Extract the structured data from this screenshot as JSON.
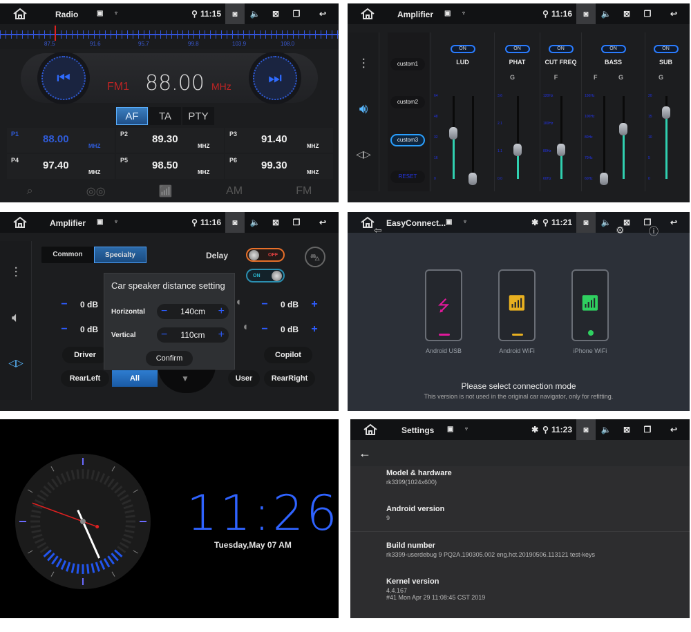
{
  "radio": {
    "title": "Radio",
    "time": "11:15",
    "scale_labels": [
      "87.5",
      "91.6",
      "95.7",
      "99.8",
      "103.9",
      "108.0"
    ],
    "band": "FM1",
    "frequency": "88.00",
    "unit": "MHz",
    "tabs": [
      {
        "label": "AF",
        "active": true
      },
      {
        "label": "TA",
        "active": false
      },
      {
        "label": "PTY",
        "active": false
      }
    ],
    "presets": [
      {
        "name": "P1",
        "value": "88.00",
        "unit": "MHZ",
        "selected": true
      },
      {
        "name": "P2",
        "value": "89.30",
        "unit": "MHZ"
      },
      {
        "name": "P3",
        "value": "91.40",
        "unit": "MHZ"
      },
      {
        "name": "P4",
        "value": "97.40",
        "unit": "MHZ"
      },
      {
        "name": "P5",
        "value": "98.50",
        "unit": "MHZ"
      },
      {
        "name": "P6",
        "value": "99.30",
        "unit": "MHZ"
      }
    ],
    "bottom": {
      "search": "⌕",
      "stereo": "◎◎",
      "antenna": "📶",
      "am": "AM",
      "fm": "FM"
    }
  },
  "amp_eq": {
    "title": "Amplifier",
    "time": "11:16",
    "presets": [
      "custom1",
      "custom2",
      "custom3",
      "RESET"
    ],
    "selected_preset": "custom3",
    "columns": [
      {
        "name": "LUD",
        "toggle": "ON",
        "sub": "",
        "ticks": [
          "64",
          "48",
          "32",
          "16",
          "0"
        ],
        "sliders": [
          0.55,
          0.0
        ]
      },
      {
        "name": "PHAT",
        "toggle": "ON",
        "sub": "G",
        "ticks": [
          "3.6",
          "2.1",
          "1.1",
          "0.0"
        ],
        "sliders": [
          0.35
        ]
      },
      {
        "name": "CUT FREQ",
        "toggle": "ON",
        "sub": "F",
        "ticks": [
          "120Hz",
          "100Hz",
          "80Hz",
          "60Hz"
        ],
        "sliders": [
          0.35
        ]
      },
      {
        "name": "BASS",
        "toggle": "ON",
        "sub": "F G",
        "ticks": [
          "150Hz",
          "100Hz",
          "80Hz",
          "70Hz",
          "60Hz"
        ],
        "sliders": [
          0.0,
          0.6
        ]
      },
      {
        "name": "SUB",
        "toggle": "ON",
        "sub": "G",
        "ticks": [
          "20",
          "15",
          "10",
          "5",
          "0"
        ],
        "sliders": [
          0.8
        ]
      }
    ]
  },
  "amp_spec": {
    "title": "Amplifier",
    "time": "11:16",
    "tabs": [
      "Common",
      "Specialty"
    ],
    "active_tab": "Specialty",
    "delay_label": "Delay",
    "toggle_off": "OFF",
    "toggle_on": "ON",
    "levels": [
      "0 dB",
      "0 dB",
      "0 dB",
      "0 dB"
    ],
    "dialog": {
      "title": "Car speaker distance setting",
      "horizontal_label": "Horizontal",
      "horizontal_value": "140cm",
      "vertical_label": "Vertical",
      "vertical_value": "110cm",
      "confirm": "Confirm"
    },
    "positions": [
      "Driver",
      "Copilot",
      "RearLeft",
      "All",
      "User",
      "RearRight"
    ]
  },
  "easyconnect": {
    "title": "EasyConnect...",
    "time": "11:21",
    "modes": [
      {
        "label": "Android USB",
        "color": "#e0199a",
        "icon": "usb"
      },
      {
        "label": "Android WiFi",
        "color": "#e8b020",
        "icon": "wifi"
      },
      {
        "label": "iPhone WiFi",
        "color": "#2fd060",
        "icon": "wifi"
      }
    ],
    "prompt": "Please select connection mode",
    "note": "This version is not used in the original car navigator, only for refitting."
  },
  "clock": {
    "time": "11:26",
    "date": "Tuesday,May 07 AM"
  },
  "settings": {
    "title": "Settings",
    "time": "11:23",
    "items": [
      {
        "title": "Model & hardware",
        "lines": [
          "rk3399(1024x600)"
        ]
      },
      {
        "title": "Android version",
        "lines": [
          "9"
        ]
      },
      {
        "title": "Build number",
        "lines": [
          "rk3399-userdebug 9 PQ2A.190305.002 eng.hct.20190506.113121 test-keys"
        ]
      },
      {
        "title": "Kernel version",
        "lines": [
          "4.4.167",
          "#41 Mon Apr 29 11:08:45 CST 2019"
        ]
      }
    ]
  }
}
